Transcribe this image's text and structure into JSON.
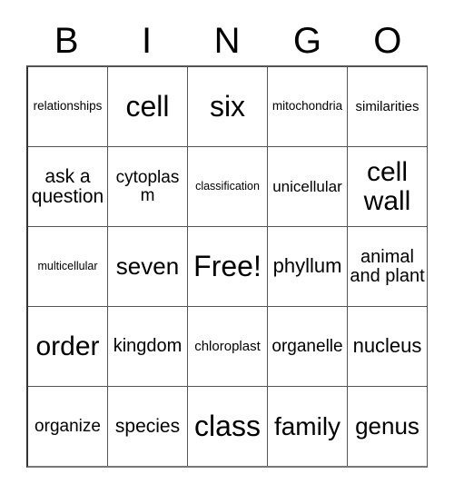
{
  "card": {
    "header_letters": [
      "B",
      "I",
      "N",
      "G",
      "O"
    ],
    "rows": [
      [
        {
          "text": "relationships",
          "size": "fs-13"
        },
        {
          "text": "cell",
          "size": "fs-32"
        },
        {
          "text": "six",
          "size": "fs-32"
        },
        {
          "text": "mitochondria",
          "size": "fs-13"
        },
        {
          "text": "similarities",
          "size": "fs-15"
        }
      ],
      [
        {
          "text": "ask a question",
          "size": "fs-21"
        },
        {
          "text": "cytoplasm",
          "size": "fs-19"
        },
        {
          "text": "classification",
          "size": "fs-12"
        },
        {
          "text": "unicellular",
          "size": "fs-17"
        },
        {
          "text": "cell wall",
          "size": "fs-30"
        }
      ],
      [
        {
          "text": "multicellular",
          "size": "fs-12"
        },
        {
          "text": "seven",
          "size": "fs-26"
        },
        {
          "text": "Free!",
          "size": "fs-32"
        },
        {
          "text": "phyllum",
          "size": "fs-22"
        },
        {
          "text": "animal and plant",
          "size": "fs-20"
        }
      ],
      [
        {
          "text": "order",
          "size": "fs-30"
        },
        {
          "text": "kingdom",
          "size": "fs-20"
        },
        {
          "text": "chloroplast",
          "size": "fs-15"
        },
        {
          "text": "organelle",
          "size": "fs-19"
        },
        {
          "text": "nucleus",
          "size": "fs-22"
        }
      ],
      [
        {
          "text": "organize",
          "size": "fs-19"
        },
        {
          "text": "species",
          "size": "fs-21"
        },
        {
          "text": "class",
          "size": "fs-32"
        },
        {
          "text": "family",
          "size": "fs-28"
        },
        {
          "text": "genus",
          "size": "fs-26"
        }
      ]
    ]
  },
  "colors": {
    "background": "#ffffff",
    "text": "#000000",
    "grid_line": "#555555"
  }
}
